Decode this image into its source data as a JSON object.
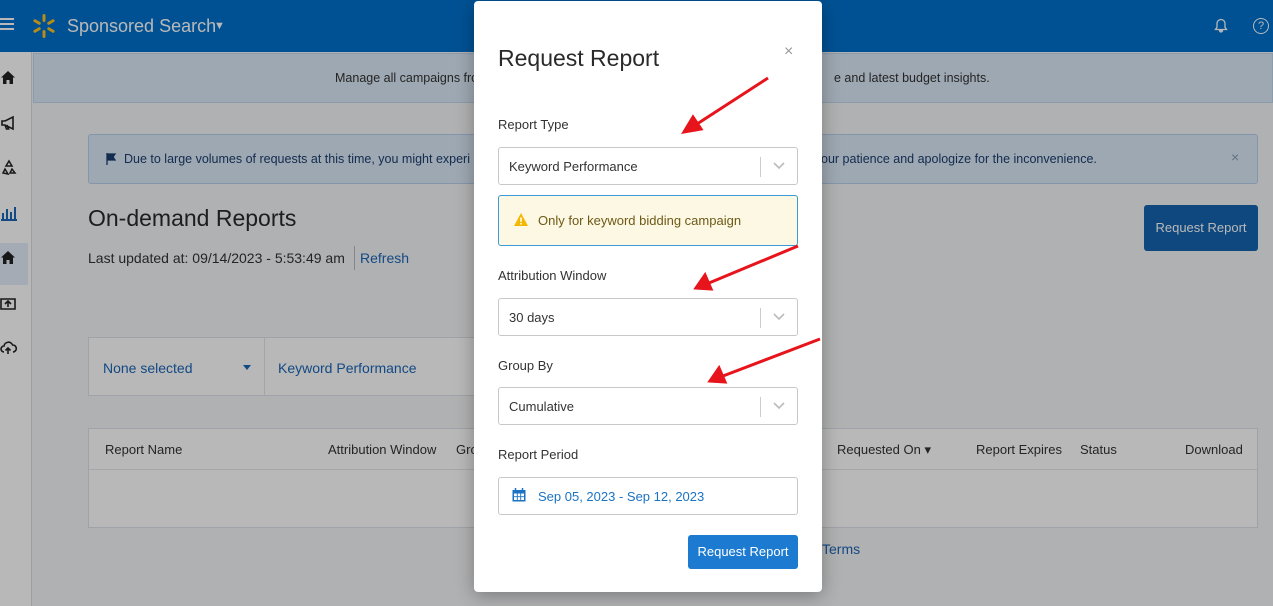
{
  "header": {
    "title": "Sponsored Search"
  },
  "banner": {
    "text_left": "Manage all campaigns fro",
    "text_right": "e and latest budget insights."
  },
  "alert": {
    "text_left": "Due to large volumes of requests at this time, you might experi",
    "text_right": "our patience and apologize for the inconvenience.",
    "close": "×"
  },
  "page": {
    "title": "On-demand Reports",
    "last_updated": "Last updated at: 09/14/2023 - 5:53:49 am",
    "refresh": "Refresh",
    "request_button": "Request Report"
  },
  "filters": {
    "selector": "None selected",
    "report_type": "Keyword Performance"
  },
  "table": {
    "columns": [
      "Report Name",
      "Attribution Window",
      "Gro",
      "Requested On",
      "Report Expires",
      "Status",
      "Download"
    ],
    "sort_indicator": "▾"
  },
  "footer": {
    "terms": "Terms"
  },
  "modal": {
    "title": "Request Report",
    "close": "×",
    "report_type_label": "Report Type",
    "report_type_value": "Keyword Performance",
    "warning": "Only for keyword bidding campaign",
    "attribution_label": "Attribution Window",
    "attribution_value": "30 days",
    "group_by_label": "Group By",
    "group_by_value": "Cumulative",
    "period_label": "Report Period",
    "period_value": "Sep 05, 2023 - Sep 12, 2023",
    "submit": "Request Report"
  },
  "colors": {
    "header_blue": "#0071ce",
    "accent_yellow": "#ffc220",
    "link_blue": "#1b66b7",
    "annotation_red": "#e8141b"
  }
}
